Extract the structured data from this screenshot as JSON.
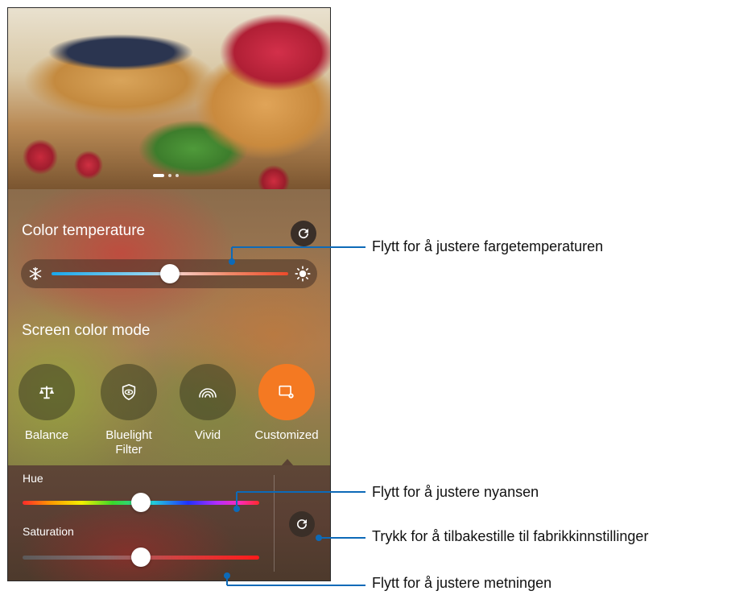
{
  "screen": {
    "pager_dots": 3,
    "pager_active_index": 0
  },
  "color_temperature": {
    "title": "Color temperature",
    "slider_value": 0.5,
    "cold_icon": "snowflake-icon",
    "warm_icon": "sun-icon",
    "reset_icon": "refresh-icon"
  },
  "screen_color_mode": {
    "title": "Screen color mode",
    "modes": [
      {
        "label": "Balance",
        "icon": "scale-icon",
        "selected": false
      },
      {
        "label": "Bluelight\nFilter",
        "icon": "eye-shield-icon",
        "selected": false
      },
      {
        "label": "Vivid",
        "icon": "rainbow-icon",
        "selected": false
      },
      {
        "label": "Customized",
        "icon": "custom-screen-icon",
        "selected": true
      }
    ]
  },
  "custom_controls": {
    "hue_label": "Hue",
    "hue_value": 0.5,
    "saturation_label": "Saturation",
    "saturation_value": 0.5,
    "reset_icon": "refresh-icon"
  },
  "callouts": [
    "Flytt for å justere fargetemperaturen",
    "Flytt for å justere nyansen",
    "Trykk for å tilbakestille til fabrikkinnstillinger",
    "Flytt for å justere metningen"
  ],
  "colors": {
    "accent_orange": "#f47922",
    "callout_blue": "#0d6ab8"
  }
}
